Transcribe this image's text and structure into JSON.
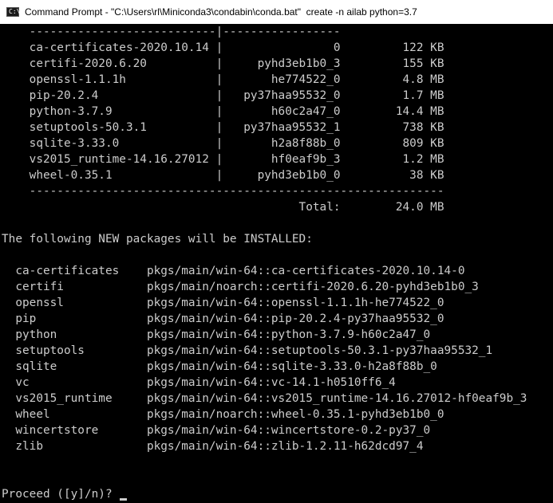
{
  "window": {
    "title": "Command Prompt - \"C:\\Users\\rl\\Miniconda3\\condabin\\conda.bat\"  create -n ailab python=3.7",
    "icon": "command-prompt-icon"
  },
  "colors": {
    "console_background": "#000000",
    "console_text": "#cccccc",
    "titlebar_background": "#ffffff"
  },
  "console": {
    "lines": [
      "    ---------------------------|-----------------",
      "    ca-certificates-2020.10.14 |                0         122 KB",
      "    certifi-2020.6.20          |     pyhd3eb1b0_3         155 KB",
      "    openssl-1.1.1h             |       he774522_0         4.8 MB",
      "    pip-20.2.4                 |   py37haa95532_0         1.7 MB",
      "    python-3.7.9               |       h60c2a47_0        14.4 MB",
      "    setuptools-50.3.1          |   py37haa95532_1         738 KB",
      "    sqlite-3.33.0              |       h2a8f88b_0         809 KB",
      "    vs2015_runtime-14.16.27012 |       hf0eaf9b_3         1.2 MB",
      "    wheel-0.35.1               |     pyhd3eb1b0_0          38 KB",
      "    ------------------------------------------------------------",
      "                                           Total:        24.0 MB",
      "",
      "The following NEW packages will be INSTALLED:",
      "",
      "  ca-certificates    pkgs/main/win-64::ca-certificates-2020.10.14-0",
      "  certifi            pkgs/main/noarch::certifi-2020.6.20-pyhd3eb1b0_3",
      "  openssl            pkgs/main/win-64::openssl-1.1.1h-he774522_0",
      "  pip                pkgs/main/win-64::pip-20.2.4-py37haa95532_0",
      "  python             pkgs/main/win-64::python-3.7.9-h60c2a47_0",
      "  setuptools         pkgs/main/win-64::setuptools-50.3.1-py37haa95532_1",
      "  sqlite             pkgs/main/win-64::sqlite-3.33.0-h2a8f88b_0",
      "  vc                 pkgs/main/win-64::vc-14.1-h0510ff6_4",
      "  vs2015_runtime     pkgs/main/win-64::vs2015_runtime-14.16.27012-hf0eaf9b_3",
      "  wheel              pkgs/main/noarch::wheel-0.35.1-pyhd3eb1b0_0",
      "  wincertstore       pkgs/main/win-64::wincertstore-0.2-py37_0",
      "  zlib               pkgs/main/win-64::zlib-1.2.11-h62dcd97_4",
      "",
      "",
      "Proceed ([y]/n)? "
    ]
  }
}
